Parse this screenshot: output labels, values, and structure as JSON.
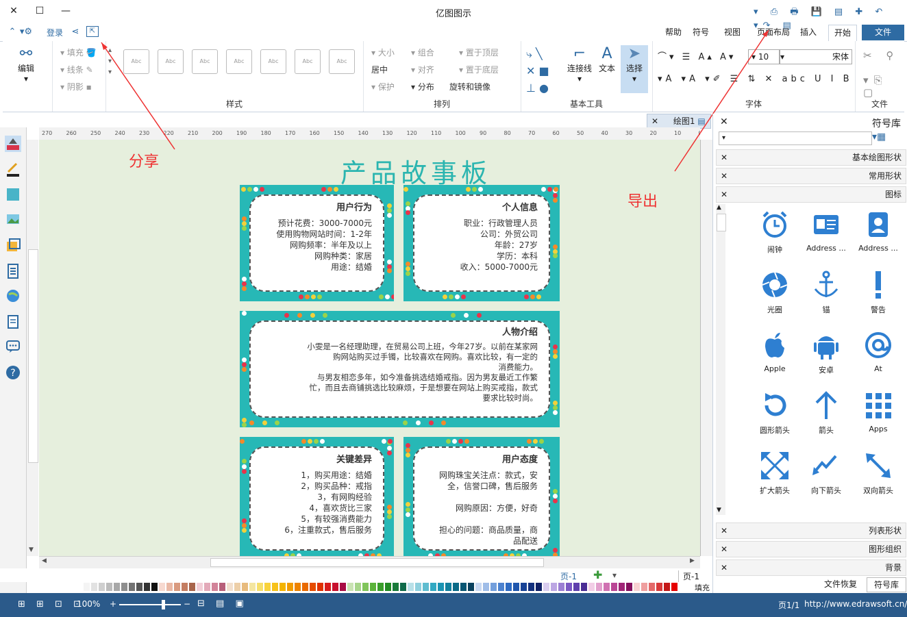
{
  "app": {
    "title": "亿图图示"
  },
  "tabs": [
    {
      "label": "文件"
    },
    {
      "label": "开始"
    },
    {
      "label": "插入"
    },
    {
      "label": "页面布局"
    },
    {
      "label": "视图"
    },
    {
      "label": "符号"
    },
    {
      "label": "帮助"
    }
  ],
  "quickbar": {
    "login": "登录"
  },
  "ribbon": {
    "file_group": "文件",
    "font_group": "字体",
    "font_name": "宋体",
    "font_size": "10",
    "basic_tools_group": "基本工具",
    "select": "选择",
    "text": "文本",
    "connector": "连接线",
    "arrange_group": "排列",
    "arrange": [
      "置于顶层",
      "组合",
      "大小",
      "置于底层",
      "对齐",
      "居中",
      "旋转和镜像",
      "分布",
      "保护"
    ],
    "style_group": "样式",
    "style_box": "Abc",
    "fill": [
      "填充",
      "线条",
      "阴影"
    ],
    "edit": "编辑"
  },
  "document": {
    "tab": "绘图1",
    "ruler": [
      "270",
      "260",
      "250",
      "240",
      "230",
      "220",
      "210",
      "200",
      "190",
      "180",
      "170",
      "160",
      "150",
      "140",
      "130",
      "120",
      "110",
      "100",
      "90",
      "80",
      "70",
      "60",
      "50",
      "40",
      "30",
      "20",
      "10",
      "0"
    ],
    "title": "产品故事板",
    "cards": [
      {
        "title": "个人信息",
        "lines": [
          "职业：行政管理人员",
          "公司：外贸公司",
          "年龄：27岁",
          "学历：本科",
          "收入：5000-7000元"
        ]
      },
      {
        "title": "用户行为",
        "lines": [
          "预计花费：3000-7000元",
          "使用购物网站时间：1-2年",
          "网购频率：半年及以上",
          "网购种类：家居",
          "用途：结婚"
        ]
      },
      {
        "title": "人物介绍",
        "lines": [
          "小雯是一名经理助理，在贸易公司上班，今年27岁。以前在某家网",
          "购网站购买过手镯，比较喜欢在网购。喜欢比较，有一定的",
          "消费能力。",
          "与男友相恋多年，如今准备挑选结婚戒指。因为男友最近工作繁",
          "忙，而且去商铺挑选比较麻烦，于是想要在网站上购买戒指，款式",
          "要求比较时尚。"
        ]
      },
      {
        "title": "用户态度",
        "lines": [
          "网购珠宝关注点：款式，安",
          "全，信誉口碑，售后服务",
          "",
          "网购原因：方便，好奇",
          "",
          "担心的问题：商品质量，商",
          "品配送"
        ]
      },
      {
        "title": "关键差异",
        "lines": [
          "1，购买用途：结婚",
          "2，购买品种：戒指",
          "3，有网购经验",
          "4，喜欢货比三家",
          "5，有较强消费能力",
          "6，注重款式，售后服务"
        ]
      }
    ]
  },
  "annotations": {
    "share": "分享",
    "export": "导出"
  },
  "pages": {
    "current": "页-1",
    "tab": "页-1",
    "page_count": "页1/1"
  },
  "status": {
    "url": "http://www.edrawsoft.cn/",
    "zoom": "100%",
    "fill_label": "填充"
  },
  "panel": {
    "title": "符号库",
    "sections": [
      "基本绘图形状",
      "常用形状",
      "图标"
    ],
    "bottom_sections": [
      "列表形状",
      "图形组织",
      "背景"
    ],
    "bottom_tabs": [
      "符号库",
      "文件恢复"
    ],
    "icons": [
      {
        "label": "Address ...",
        "icon": "address-book-icon"
      },
      {
        "label": "Address ...",
        "icon": "contact-card-icon"
      },
      {
        "label": "闹钟",
        "icon": "alarm-clock-icon"
      },
      {
        "label": "警告",
        "icon": "exclamation-icon"
      },
      {
        "label": "锚",
        "icon": "anchor-icon"
      },
      {
        "label": "光圈",
        "icon": "aperture-icon"
      },
      {
        "label": "At",
        "icon": "at-icon"
      },
      {
        "label": "安卓",
        "icon": "android-icon"
      },
      {
        "label": "Apple",
        "icon": "apple-icon"
      },
      {
        "label": "Apps",
        "icon": "apps-grid-icon"
      },
      {
        "label": "箭头",
        "icon": "arrow-up-icon"
      },
      {
        "label": "圆形箭头",
        "icon": "circular-arrow-icon"
      },
      {
        "label": "双向箭头",
        "icon": "double-arrow-icon"
      },
      {
        "label": "向下箭头",
        "icon": "trend-down-arrow-icon"
      },
      {
        "label": "扩大箭头",
        "icon": "expand-arrow-icon"
      }
    ]
  },
  "colors": {
    "accent": "#2e6ba3",
    "teal": "#27b8b6",
    "annotation": "#e33333",
    "status": "#2b5a8a"
  }
}
